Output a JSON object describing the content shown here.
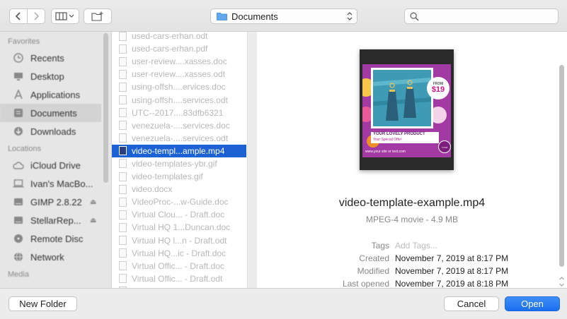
{
  "toolbar": {
    "location": "Documents",
    "search_placeholder": ""
  },
  "sidebar": {
    "favorites_header": "Favorites",
    "favorites": [
      {
        "label": "Recents",
        "icon": "clock-icon"
      },
      {
        "label": "Desktop",
        "icon": "desktop-icon"
      },
      {
        "label": "Applications",
        "icon": "applications-icon"
      },
      {
        "label": "Documents",
        "icon": "documents-icon",
        "selected": true
      },
      {
        "label": "Downloads",
        "icon": "downloads-icon"
      }
    ],
    "locations_header": "Locations",
    "locations": [
      {
        "label": "iCloud Drive",
        "icon": "cloud-icon"
      },
      {
        "label": "Ivan's MacBo...",
        "icon": "laptop-icon"
      },
      {
        "label": "GIMP 2.8.22",
        "icon": "drive-icon",
        "eject": true
      },
      {
        "label": "StellarRep...",
        "icon": "drive-icon",
        "eject": true
      },
      {
        "label": "Remote Disc",
        "icon": "disc-icon"
      },
      {
        "label": "Network",
        "icon": "network-icon"
      }
    ],
    "media_header": "Media"
  },
  "files": [
    "used-cars-erhan.odt",
    "used-cars-erhan.pdf",
    "user-review....xasses.doc",
    "user-review....xasses.odt",
    "using-offsh....ervices.doc",
    "using-offsh....services.odt",
    "UTC--2017....83dfb6321",
    "venezuela-....services.doc",
    "venezuela-....services.odt",
    "video-templ...ample.mp4",
    "video-templates-ybr.gif",
    "video-templates.gif",
    "video.docx",
    "VideoProc-...w-Guide.doc",
    "Virtual Clou... - Draft.doc",
    "Virtual HQ 1...Duncan.doc",
    "Virtual HQ l...n - Draft.odt",
    "Virtual HQ...ic - Draft.doc",
    "Virtual Offic... - Draft.doc",
    "Virtual Offic... - Draft.odt",
    "Virtual Offic... - Draft..."
  ],
  "selected_file_index": 9,
  "preview": {
    "thumbnail": {
      "price_from": "FROM",
      "price": "$19",
      "caption_title": "YOUR LOVELY PRODUCT",
      "caption_sub": "Your Special Offer",
      "footer_text": "www.your site or text.com",
      "badge_text": "YOUR LOGO HERE"
    },
    "filename": "video-template-example.mp4",
    "type_size": "MPEG-4 movie - 4.9 MB",
    "tags_label": "Tags",
    "tags_placeholder": "Add Tags...",
    "created_label": "Created",
    "created": "November 7, 2019 at 8:17 PM",
    "modified_label": "Modified",
    "modified": "November 7, 2019 at 8:17 PM",
    "last_opened_label": "Last opened",
    "last_opened": "November 7, 2019 at 8:18 PM"
  },
  "footer": {
    "new_folder": "New Folder",
    "cancel": "Cancel",
    "open": "Open"
  },
  "colors": {
    "accent": "#1b6ff0",
    "selection": "#1d62d4",
    "thumbnail_bg": "#a33aa4"
  }
}
